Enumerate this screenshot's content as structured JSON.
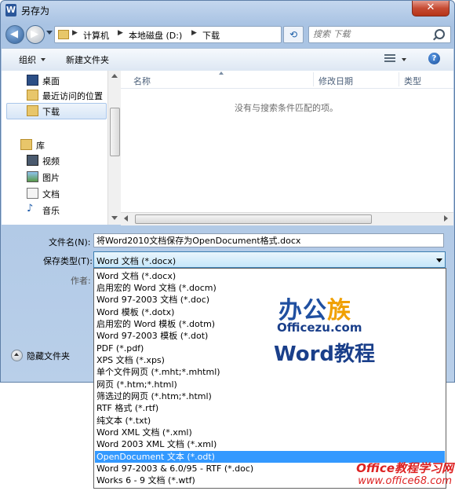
{
  "window": {
    "title": "另存为",
    "app_icon": "W",
    "close_label": "✕"
  },
  "nav": {
    "address": {
      "crumbs": [
        "计算机",
        "本地磁盘 (D:)",
        "下载"
      ],
      "separator": "▶"
    },
    "refresh_icon": "⟲",
    "search_placeholder": "搜索 下载"
  },
  "toolbar": {
    "organize": "组织",
    "new_folder": "新建文件夹",
    "help": "?"
  },
  "sidebar": {
    "items": [
      {
        "label": "桌面",
        "icon": "desktop-icon"
      },
      {
        "label": "最近访问的位置",
        "icon": "recent-places-icon"
      },
      {
        "label": "下载",
        "icon": "downloads-icon",
        "selected": true
      },
      {
        "label": "库",
        "icon": "library-icon"
      },
      {
        "label": "视频",
        "icon": "videos-icon"
      },
      {
        "label": "图片",
        "icon": "pictures-icon"
      },
      {
        "label": "文档",
        "icon": "documents-icon"
      },
      {
        "label": "音乐",
        "icon": "music-icon"
      }
    ]
  },
  "file_list": {
    "columns": [
      "名称",
      "修改日期",
      "类型"
    ],
    "empty_message": "没有与搜索条件匹配的项。"
  },
  "form": {
    "filename_label": "文件名(N):",
    "filename_value": "将Word2010文档保存为OpenDocument格式.docx",
    "filetype_label": "保存类型(T):",
    "filetype_value": "Word 文档 (*.docx)",
    "author_label": "作者:",
    "hide_folders": "隐藏文件夹"
  },
  "filetype_options": [
    "Word 文档 (*.docx)",
    "启用宏的 Word 文档 (*.docm)",
    "Word 97-2003 文档 (*.doc)",
    "Word 模板 (*.dotx)",
    "启用宏的 Word 模板 (*.dotm)",
    "Word 97-2003 模板 (*.dot)",
    "PDF (*.pdf)",
    "XPS 文档 (*.xps)",
    "单个文件网页 (*.mht;*.mhtml)",
    "网页 (*.htm;*.html)",
    "筛选过的网页 (*.htm;*.html)",
    "RTF 格式 (*.rtf)",
    "纯文本 (*.txt)",
    "Word XML 文档 (*.xml)",
    "Word 2003 XML 文档 (*.xml)",
    "OpenDocument 文本 (*.odt)",
    "Word 97-2003 & 6.0/95 - RTF (*.doc)",
    "Works 6 - 9 文档 (*.wtf)"
  ],
  "selected_option": "OpenDocument 文本 (*.odt)",
  "watermarks": {
    "logo_cn_a": "办公",
    "logo_cn_b": "族",
    "logo_en": "Officezu.com",
    "logo_word": "Word教程",
    "site_title": "Office教程学习网",
    "site_url": "www.office68.com"
  },
  "colors": {
    "selection": "#3399ff",
    "accent": "#1f4fa0",
    "watermark_red": "#d22222"
  }
}
